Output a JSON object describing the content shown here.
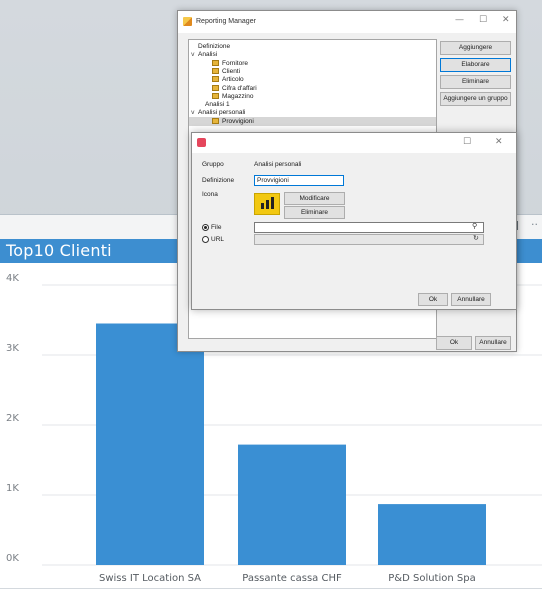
{
  "chart_window": {
    "title": "Top10  Clienti",
    "menu_glyph": "··",
    "colors": {
      "header": "#3d8ed0",
      "bar": "#3a8fd3"
    }
  },
  "chart_data": {
    "type": "bar",
    "title": "Top10  Clienti",
    "categories": [
      "Swiss IT Location SA",
      "Passante cassa CHF",
      "P&D Solution Spa"
    ],
    "values": [
      3450,
      1720,
      870
    ],
    "ylim": [
      0,
      4000
    ],
    "yticks": [
      "0K",
      "1K",
      "2K",
      "3K",
      "4K"
    ],
    "grid": true,
    "legend": "none"
  },
  "reporting_manager": {
    "title": "Reporting Manager",
    "tree": [
      {
        "label": "Definizione",
        "level": 0,
        "caret": "",
        "icon": false
      },
      {
        "label": "Analisi",
        "level": 0,
        "caret": "v",
        "icon": false
      },
      {
        "label": "Fornitore",
        "level": 2,
        "caret": "",
        "icon": true
      },
      {
        "label": "Clienti",
        "level": 2,
        "caret": "",
        "icon": true
      },
      {
        "label": "Articolo",
        "level": 2,
        "caret": "",
        "icon": true
      },
      {
        "label": "Cifra d'affari",
        "level": 2,
        "caret": "",
        "icon": true
      },
      {
        "label": "Magazzino",
        "level": 2,
        "caret": "",
        "icon": true
      },
      {
        "label": "Analisi 1",
        "level": 1,
        "caret": "",
        "icon": false
      },
      {
        "label": "Analisi personali",
        "level": 0,
        "caret": "v",
        "icon": false
      },
      {
        "label": "Provvigioni",
        "level": 2,
        "caret": "",
        "icon": true,
        "selected": true
      }
    ],
    "buttons": {
      "add": "Aggiungere",
      "edit": "Elaborare",
      "delete": "Eliminare",
      "add_group": "Aggiungere un gruppo",
      "ok": "Ok",
      "cancel": "Annullare"
    },
    "controls": {
      "minimize": "—",
      "maximize": "☐",
      "close": "✕"
    }
  },
  "dialog": {
    "group_label": "Gruppo",
    "group_value": "Analisi personali",
    "definition_label": "Definizione",
    "definition_value": "Provvigioni",
    "icon_label": "Icona",
    "modify_button": "Modificare",
    "remove_button": "Eliminare",
    "file_label": "File",
    "url_label": "URL",
    "file_value": "",
    "url_value": "",
    "ok": "Ok",
    "cancel": "Annullare",
    "file_mode": "file",
    "controls": {
      "maximize": "☐",
      "close": "✕"
    }
  }
}
